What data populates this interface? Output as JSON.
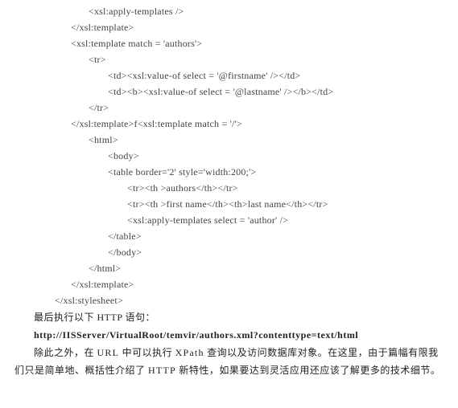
{
  "code": {
    "l01": "<xsl:apply-templates />",
    "l02": "</xsl:template>",
    "l03": "<xsl:template match = 'authors'>",
    "l04": "<tr>",
    "l05": "<td><xsl:value-of select = '@firstname' /></td>",
    "l06": "<td><b><xsl:value-of select = '@lastname' /></b></td>",
    "l07": "</tr>",
    "l08": "</xsl:template>f<xsl:template match = '/'>",
    "l09": "<html>",
    "l10": "<body>",
    "l11": "<table border='2' style='width:200;'>",
    "l12": "<tr><th >authors</th></tr>",
    "l13": "<tr><th >first name</th><th>last name</th></tr>",
    "l14": "<xsl:apply-templates select = 'author' />",
    "l15": "</table>",
    "l16": "</body>",
    "l17": "</html>",
    "l18": "</xsl:template>",
    "l19": "</xsl:stylesheet>"
  },
  "text": {
    "p1": "最后执行以下 HTTP 语句：",
    "p2": "http://IISServer/VirtualRoot/temvir/authors.xml?contenttype=text/html",
    "p3a": "除此之外，在",
    "p3b": "URL",
    "p3c": "中可以执行",
    "p3d": "XPath",
    "p3e": "查询以及访问数据库对象。在这里，由于篇幅有限我们只是简单地、概括性介绍了",
    "p3f": "HTTP",
    "p3g": "新特性，如果要达到灵活应用还应该了解更多的技术细节。"
  }
}
